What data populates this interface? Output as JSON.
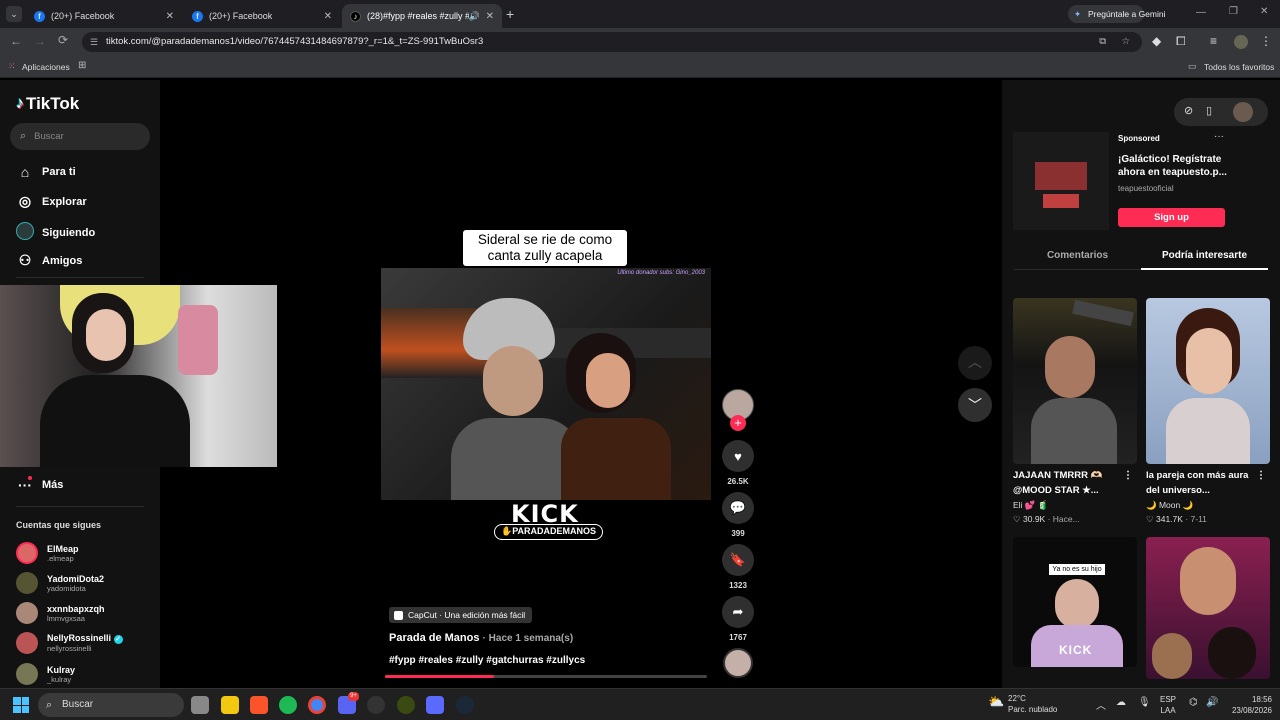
{
  "browser": {
    "tabs": [
      {
        "title": "(20+) Facebook",
        "icon": "facebook-icon"
      },
      {
        "title": "(20+) Facebook",
        "icon": "facebook-icon"
      },
      {
        "title": "(28)#fypp #reales #zully #g",
        "icon": "tiktok-icon"
      }
    ],
    "new_tab": "+",
    "gemini": "Pregúntale a Gemini",
    "url": "tiktok.com/@paradademanos1/video/7674457431484697879?_r=1&_t=ZS-991TwBuOsr3",
    "bookmarks": {
      "apps": "Aplicaciones",
      "all": "Todos los favoritos"
    }
  },
  "tiktok": {
    "logo": "TikTok",
    "search_placeholder": "Buscar",
    "nav": [
      "Para ti",
      "Explorar",
      "Siguiendo",
      "Amigos"
    ],
    "more": "Más",
    "following_title": "Cuentas que sigues",
    "following": [
      {
        "name": "ElMeap",
        "user": ".elmeap"
      },
      {
        "name": "YadomiDota2",
        "user": "yadomidota"
      },
      {
        "name": "xxnnbapxzqh",
        "user": "lmmvgxsaa"
      },
      {
        "name": "NellyRossinelli",
        "user": "nellyrossinelli"
      },
      {
        "name": "Kulray",
        "user": "_kulray"
      }
    ]
  },
  "video": {
    "caption_line1": "Sideral se rie de como",
    "caption_line2": "canta zully acapela",
    "watermark": "Ultimo donador subs: Gino_2003",
    "kick": "KICK",
    "kick_handle": "PARADADEMANOS",
    "capcut": "CapCut · Una edición más fácil",
    "author": "Parada de Manos",
    "time": "· Hace 1 semana(s)",
    "hashtags": "#fypp #reales #zully #gatchurras #zullycs",
    "likes": "26.5K",
    "comments": "399",
    "saves": "1323",
    "shares": "1767",
    "progress": 0.34
  },
  "right": {
    "ad": {
      "label": "Sponsored",
      "title_line1": "¡Galáctico! Regístrate",
      "title_line2": "ahora en teapuesto.p...",
      "account": "teapuestooficial",
      "cta": "Sign up"
    },
    "tabs": [
      "Comentarios",
      "Podría interesarte"
    ],
    "cards": [
      {
        "title1": "JAJAAN TMRRR 🫶🏻",
        "title2": "@MOOD STAR ★...",
        "author": "Eli 💕 🧃",
        "views": "30.9K",
        "date": "· Hace..."
      },
      {
        "title1": "la pareja con más aura",
        "title2": "del universo...",
        "author": "🌙 Moon 🌙",
        "views": "341.7K",
        "date": "· 7-11"
      },
      {
        "thumb_text": "Ya no es su hijo",
        "kick": "KICK"
      },
      {}
    ]
  },
  "taskbar": {
    "search": "Buscar",
    "temp": "22°C",
    "weather": "Parc. nublado",
    "lang1": "ESP",
    "lang2": "LAA",
    "time": "18:56",
    "date": "23/08/2026",
    "badge": "9+"
  }
}
